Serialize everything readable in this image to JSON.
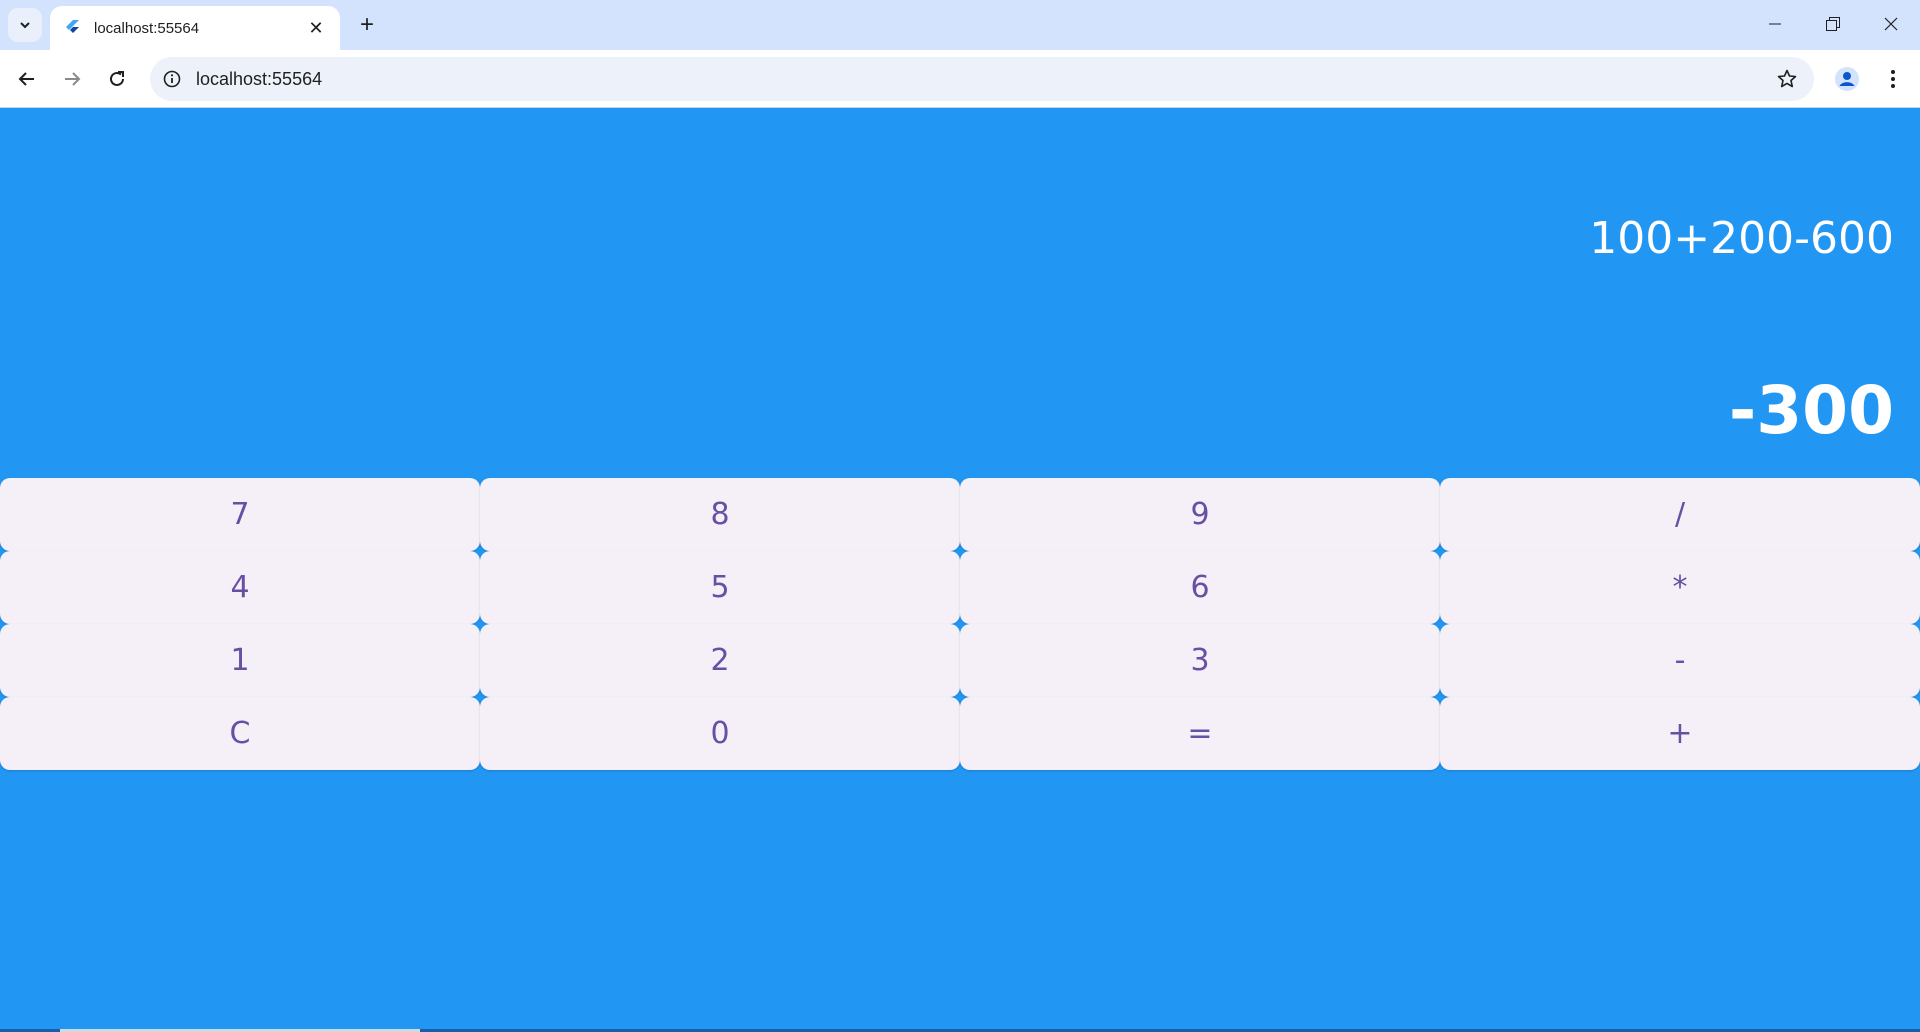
{
  "browser": {
    "tab_title": "localhost:55564",
    "address": "localhost:55564",
    "tab_close_glyph": "✕",
    "new_tab_glyph": "+",
    "icons": {
      "tab_search": "chevron-down-icon",
      "favicon": "flutter-icon",
      "back": "arrow-left-icon",
      "forward": "arrow-right-icon",
      "reload": "reload-icon",
      "site_info": "info-icon",
      "bookmark": "star-icon",
      "profile": "person-icon",
      "menu": "kebab-menu-icon",
      "minimize": "minimize-icon",
      "restore": "restore-icon",
      "close": "close-icon"
    }
  },
  "calculator": {
    "expression": "100+200-600",
    "result": "-300",
    "colors": {
      "background": "#2196f3",
      "key_background": "#f5eff7",
      "key_text": "#6750a4",
      "display_text": "#ffffff"
    },
    "keys": [
      [
        "7",
        "8",
        "9",
        "/"
      ],
      [
        "4",
        "5",
        "6",
        "*"
      ],
      [
        "1",
        "2",
        "3",
        "-"
      ],
      [
        "C",
        "0",
        "=",
        "+"
      ]
    ]
  }
}
